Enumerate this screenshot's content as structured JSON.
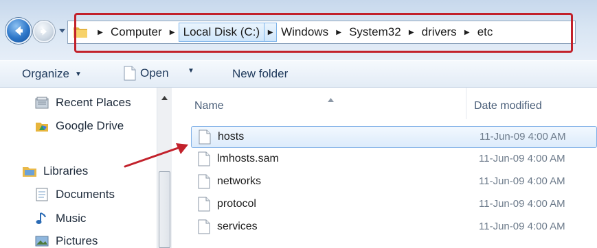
{
  "address": {
    "breadcrumbs": [
      "Computer",
      "Local Disk (C:)",
      "Windows",
      "System32",
      "drivers",
      "etc"
    ]
  },
  "toolbar": {
    "organize_label": "Organize",
    "open_label": "Open",
    "new_folder_label": "New folder"
  },
  "navigation": {
    "items": [
      {
        "label": "Recent Places",
        "icon": "recent-places-icon"
      },
      {
        "label": "Google Drive",
        "icon": "google-drive-icon"
      },
      {
        "label": "Libraries",
        "icon": "libraries-icon"
      },
      {
        "label": "Documents",
        "icon": "documents-icon"
      },
      {
        "label": "Music",
        "icon": "music-icon"
      },
      {
        "label": "Pictures",
        "icon": "pictures-icon"
      }
    ]
  },
  "file_list": {
    "columns": [
      "Name",
      "Date modified"
    ],
    "rows": [
      {
        "name": "hosts",
        "date": "11-Jun-09 4:00 AM",
        "selected": true
      },
      {
        "name": "lmhosts.sam",
        "date": "11-Jun-09 4:00 AM",
        "selected": false
      },
      {
        "name": "networks",
        "date": "11-Jun-09 4:00 AM",
        "selected": false
      },
      {
        "name": "protocol",
        "date": "11-Jun-09 4:00 AM",
        "selected": false
      },
      {
        "name": "services",
        "date": "11-Jun-09 4:00 AM",
        "selected": false
      }
    ]
  },
  "colors": {
    "annotation": "#c2212b",
    "selection": "#dcebfb",
    "text": "#1e395b"
  }
}
